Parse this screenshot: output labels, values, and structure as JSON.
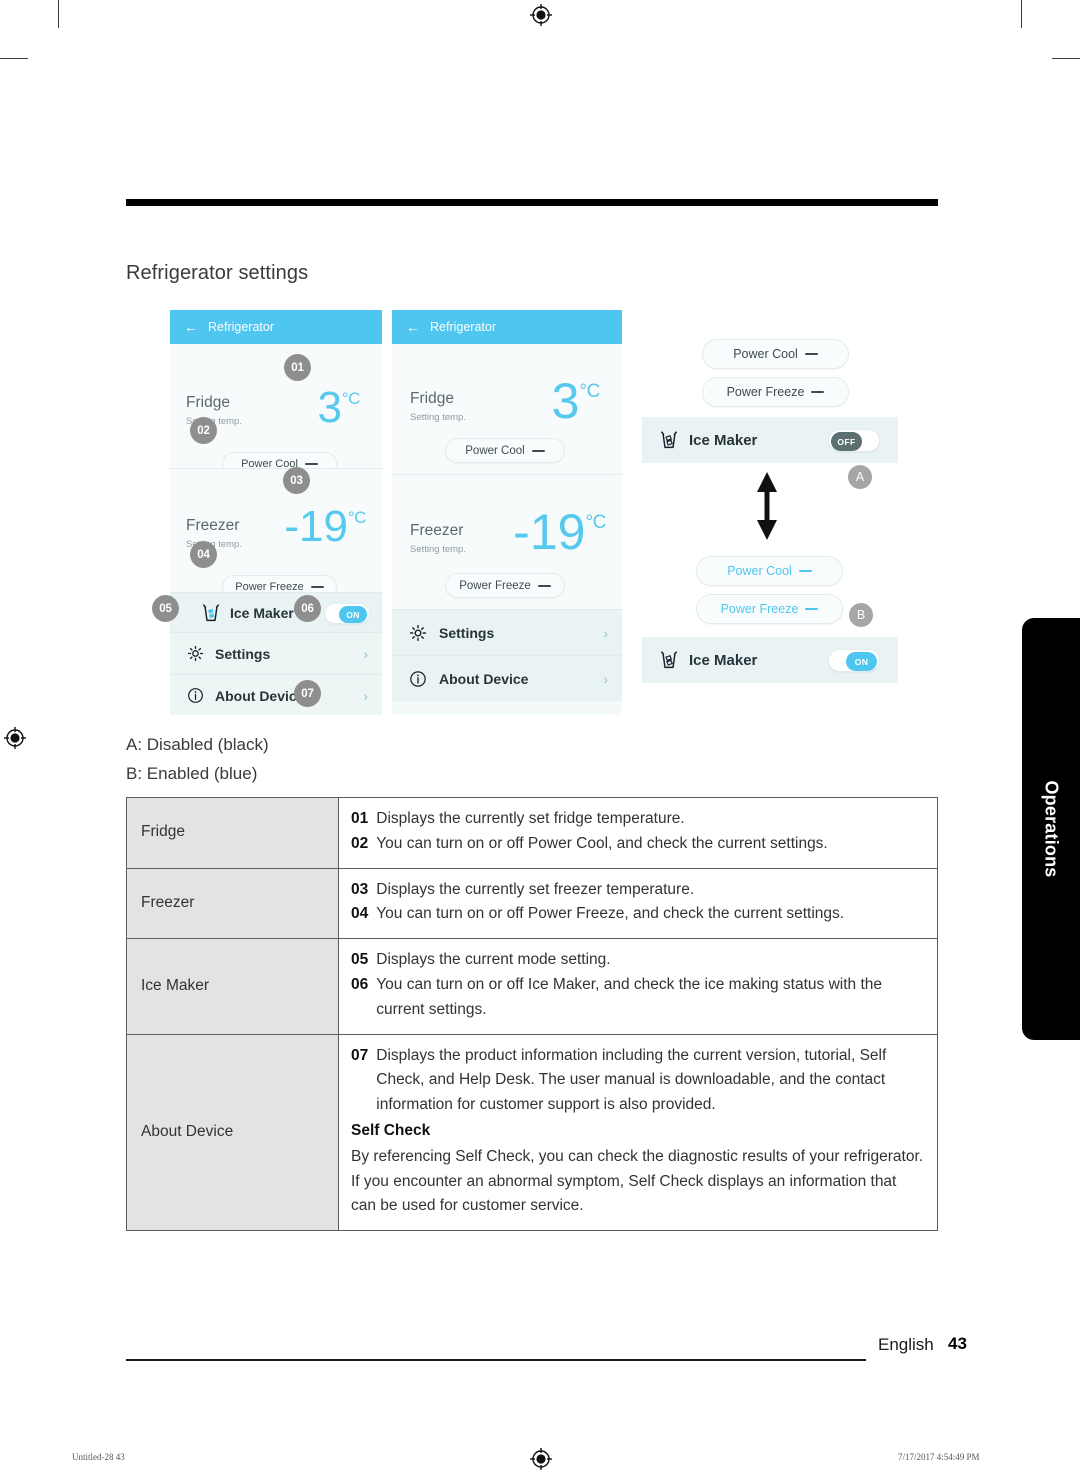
{
  "page": {
    "section_title": "Refrigerator settings",
    "legend": [
      "A: Disabled (black)",
      "B: Enabled (blue)"
    ],
    "side_tab": "Operations",
    "footer_language": "English",
    "footer_page": "43",
    "print_file": "Untitled-28   43",
    "print_date": "7/17/2017   4:54:49 PM"
  },
  "colors": {
    "accent_cyan": "#4ec6ef",
    "temp_cyan": "#57c9ee",
    "toggle_off_grey": "#5c7072",
    "badge_grey": "#8e8e8e",
    "key_cell_grey": "#e3e3e3",
    "phone_bg": "#f4f9f9"
  },
  "phone1": {
    "appbar": {
      "back_icon": "arrow-left-icon",
      "title": "Refrigerator"
    },
    "fridge": {
      "label": "Fridge",
      "sub": "Setting temp.",
      "value": "3",
      "unit": "°C",
      "badge_value": "01",
      "pill": {
        "label": "Power Cool",
        "state_icon": "dash-icon",
        "badge": "02",
        "enabled": false
      }
    },
    "freezer": {
      "label": "Freezer",
      "sub": "Setting temp.",
      "value": "-19",
      "unit": "°C",
      "badge_value": "03",
      "pill": {
        "label": "Power Freeze",
        "state_icon": "dash-icon",
        "badge": "04",
        "enabled": false
      }
    },
    "ice_maker": {
      "icon": "ice-glass-icon",
      "label": "Ice Maker",
      "badge_icon": "05",
      "badge_toggle": "06",
      "toggle": {
        "state": "on",
        "label": "ON"
      }
    },
    "settings": {
      "icon": "gear-icon",
      "label": "Settings",
      "chevron": "chevron-right-icon"
    },
    "about": {
      "icon": "info-icon",
      "label": "About Device",
      "badge": "07",
      "chevron": "chevron-right-icon"
    }
  },
  "phone2": {
    "appbar": {
      "back_icon": "arrow-left-icon",
      "title": "Refrigerator"
    },
    "fridge": {
      "label": "Fridge",
      "sub": "Setting temp.",
      "value": "3",
      "unit": "°C",
      "pill": {
        "label": "Power Cool",
        "state_icon": "dash-icon"
      }
    },
    "freezer": {
      "label": "Freezer",
      "sub": "Setting temp.",
      "value": "-19",
      "unit": "°C",
      "pill": {
        "label": "Power Freeze",
        "state_icon": "dash-icon"
      }
    },
    "settings": {
      "icon": "gear-icon",
      "label": "Settings",
      "chevron": "chevron-right-icon"
    },
    "about": {
      "icon": "info-icon",
      "label": "About Device",
      "chevron": "chevron-right-icon"
    }
  },
  "states": {
    "disabled": {
      "marker": "A",
      "power_cool": "Power Cool",
      "power_freeze": "Power Freeze",
      "ice_maker_label": "Ice Maker",
      "ice_maker_icon": "ice-glass-icon",
      "toggle": {
        "state": "off",
        "label": "OFF"
      }
    },
    "enabled": {
      "marker": "B",
      "power_cool": "Power Cool",
      "power_freeze": "Power Freeze",
      "ice_maker_label": "Ice Maker",
      "ice_maker_icon": "ice-glass-icon",
      "toggle": {
        "state": "on",
        "label": "ON"
      }
    },
    "arrow_icon": "double-arrow-vertical-icon"
  },
  "table": {
    "rows": [
      {
        "key": "Fridge",
        "items": [
          {
            "n": "01",
            "t": "Displays the currently set fridge temperature."
          },
          {
            "n": "02",
            "t": "You can turn on or off Power Cool, and check the current settings."
          }
        ]
      },
      {
        "key": "Freezer",
        "items": [
          {
            "n": "03",
            "t": "Displays the currently set freezer temperature."
          },
          {
            "n": "04",
            "t": "You can turn on or off Power Freeze, and check the current settings."
          }
        ]
      },
      {
        "key": "Ice Maker",
        "items": [
          {
            "n": "05",
            "t": "Displays the current mode setting."
          },
          {
            "n": "06",
            "t": "You can turn on or off Ice Maker, and check the ice making status with the current settings."
          }
        ]
      },
      {
        "key": "About Device",
        "items": [
          {
            "n": "07",
            "t": "Displays the product information including the current version, tutorial, Self Check, and Help Desk. The user manual is downloadable, and the contact information for customer support is also provided."
          }
        ],
        "subhead": "Self Check",
        "para": "By referencing Self Check, you can check the diagnostic results of your refrigerator. If you encounter an abnormal symptom, Self Check displays an information that can be used for customer service."
      }
    ]
  }
}
